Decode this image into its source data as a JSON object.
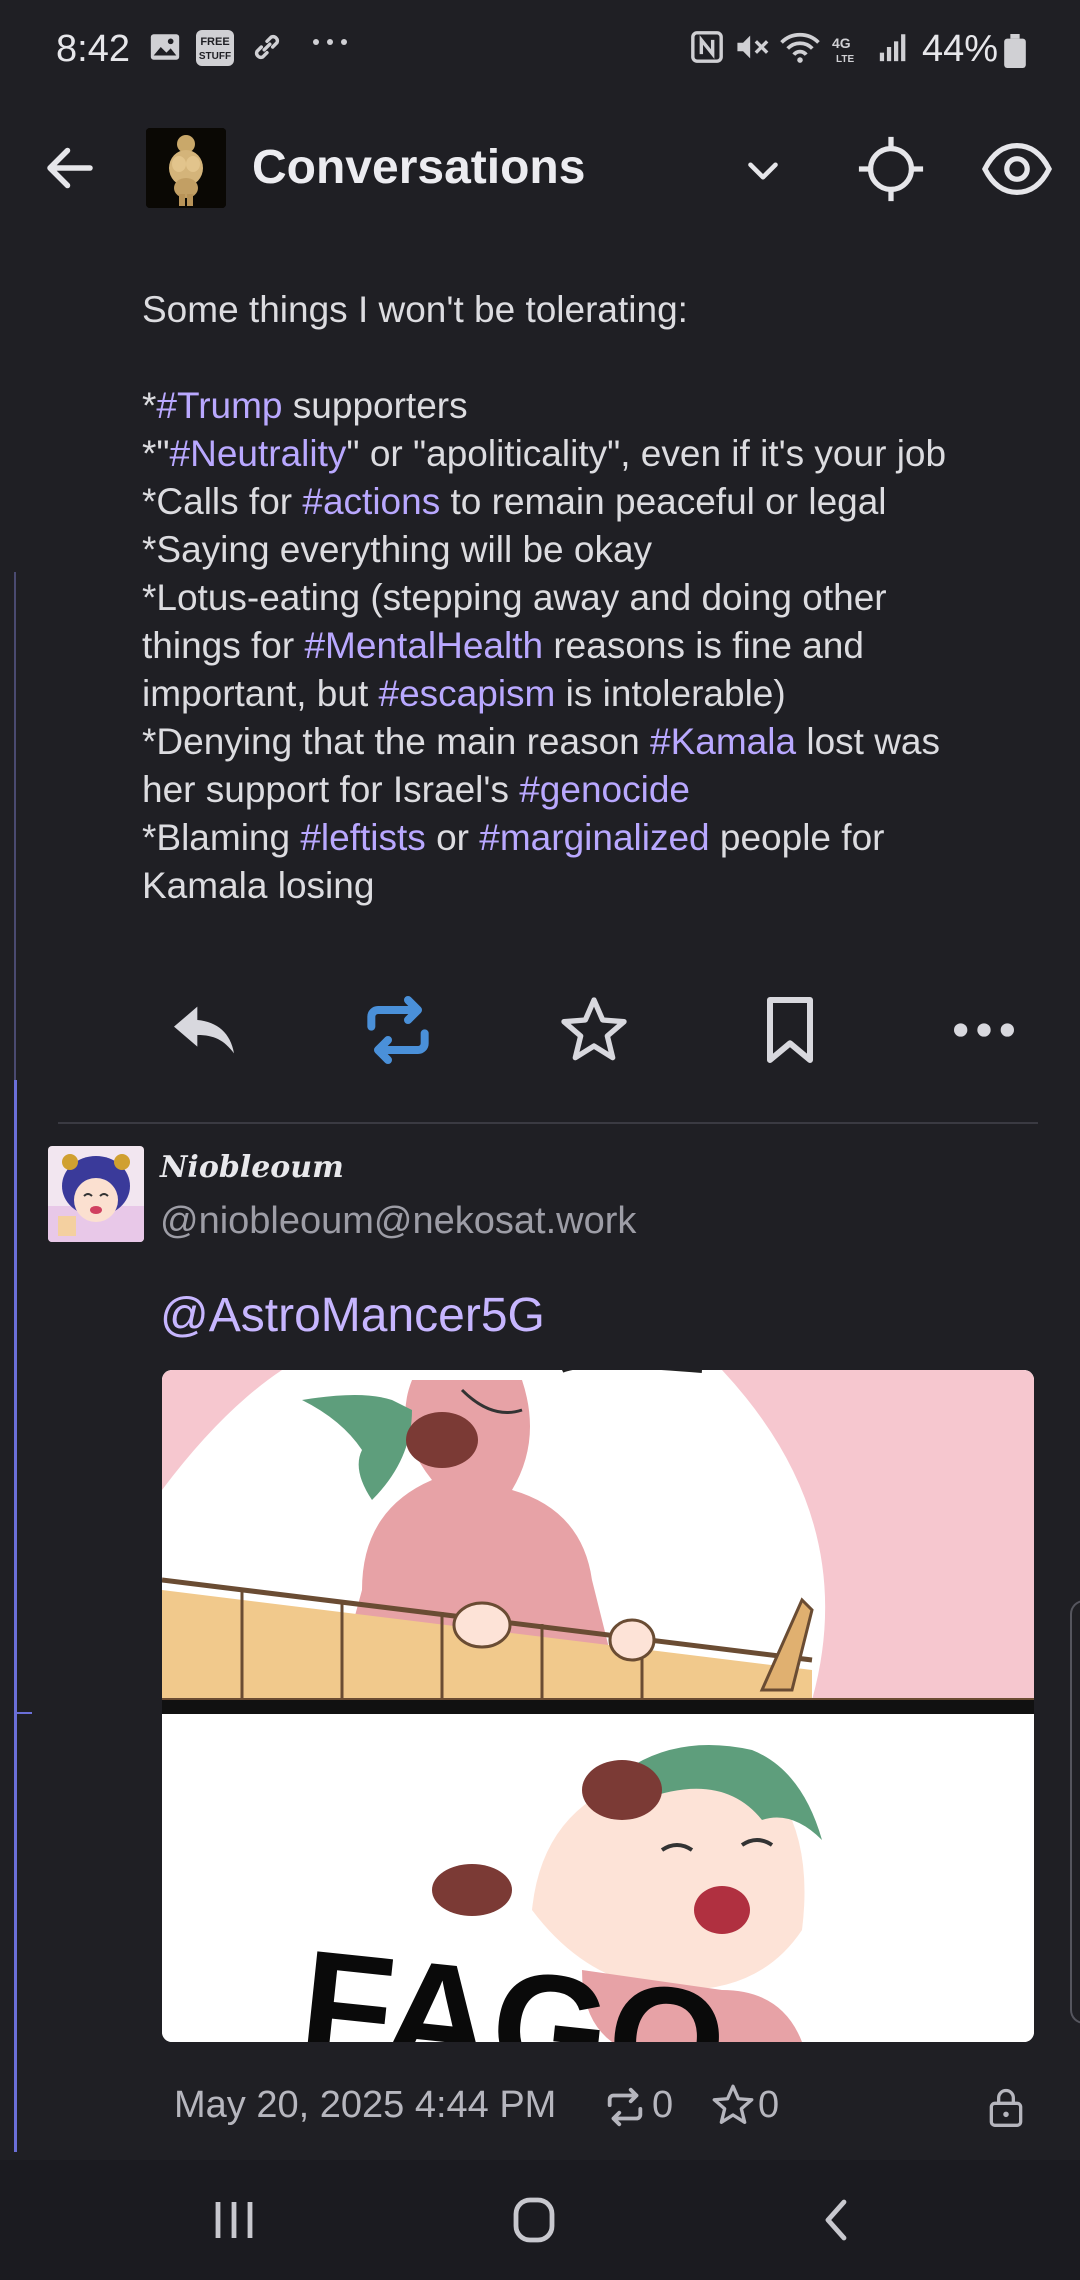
{
  "status_bar": {
    "time": "8:42",
    "icons": [
      "image-icon",
      "free-stuff-icon",
      "link-icon",
      "more-dots-icon",
      "nfc-icon",
      "mute-icon",
      "wifi-icon",
      "4g-lte-icon",
      "signal-icon",
      "battery-icon"
    ],
    "free_badge": "FREE STUFF",
    "battery": "44%"
  },
  "header": {
    "title": "Conversations",
    "icons": [
      "back-arrow-icon",
      "chevron-down-icon",
      "crosshair-icon",
      "eye-icon"
    ]
  },
  "post": {
    "lines": [
      [
        {
          "t": "Some things I won't be tolerating:"
        }
      ],
      [],
      [
        {
          "t": "*"
        },
        {
          "h": "#Trump"
        },
        {
          "t": " supporters"
        }
      ],
      [
        {
          "t": "*\""
        },
        {
          "h": "#Neutrality"
        },
        {
          "t": "\" or \"apoliticality\", even if it's your job"
        }
      ],
      [
        {
          "t": "*Calls for "
        },
        {
          "h": "#actions"
        },
        {
          "t": " to remain peaceful or legal"
        }
      ],
      [
        {
          "t": "*Saying everything will be okay"
        }
      ],
      [
        {
          "t": "*Lotus-eating (stepping away and doing other"
        }
      ],
      [
        {
          "t": "things for "
        },
        {
          "h": "#MentalHealth"
        },
        {
          "t": " reasons is fine and"
        }
      ],
      [
        {
          "t": "important, but "
        },
        {
          "h": "#escapism"
        },
        {
          "t": " is intolerable)"
        }
      ],
      [
        {
          "t": "*Denying that the main reason "
        },
        {
          "h": "#Kamala"
        },
        {
          "t": " lost was"
        }
      ],
      [
        {
          "t": "her support for Israel's "
        },
        {
          "h": "#genocide"
        }
      ],
      [
        {
          "t": "*Blaming "
        },
        {
          "h": "#leftists"
        },
        {
          "t": " or "
        },
        {
          "h": "#marginalized"
        },
        {
          "t": " people for"
        }
      ],
      [
        {
          "t": "Kamala losing"
        }
      ]
    ],
    "actions": [
      "reply-icon",
      "boost-icon",
      "favourite-star-icon",
      "bookmark-icon",
      "more-options-icon"
    ],
    "boost_color": "#4a90d9"
  },
  "reply": {
    "display_name": "Niobleoum",
    "handle": "@niobleoum@nekosat.work",
    "mention": "@AstroMancer5G",
    "attachment_text": "FAGO",
    "date": "May 20, 2025 4:44 PM",
    "boosts": "0",
    "favourites": "0",
    "meta_icons": [
      "boost-icon",
      "star-icon",
      "lock-icon"
    ]
  },
  "nav": {
    "icons": [
      "recent-apps-icon",
      "home-icon",
      "nav-back-icon"
    ]
  },
  "colors": {
    "background": "#1f1f24",
    "text": "#dcdce0",
    "hashtag": "#b9a8ff",
    "thread_line": "#6b6fd8"
  }
}
